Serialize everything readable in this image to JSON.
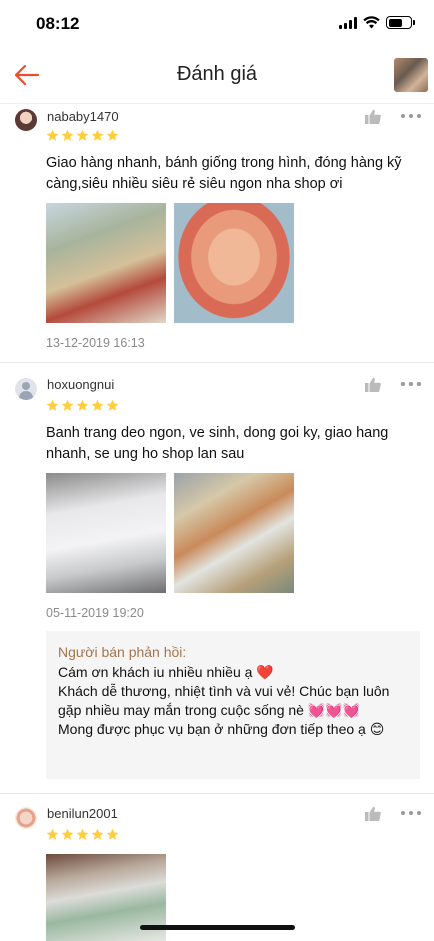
{
  "status": {
    "time": "08:12"
  },
  "header": {
    "title": "Đánh giá"
  },
  "reviews": [
    {
      "username": "nababy1470",
      "rating": 5,
      "comment": "Giao hàng nhanh, bánh giống trong hình, đóng hàng kỹ càng,siêu nhiều siêu rẻ siêu ngon nha shop ơi",
      "photo_count": 2,
      "date": "13-12-2019 16:13"
    },
    {
      "username": "hoxuongnui",
      "rating": 5,
      "comment": "Banh trang deo ngon, ve sinh, dong goi ky, giao hang nhanh, se ung ho shop lan sau",
      "photo_count": 2,
      "date": "05-11-2019 19:20",
      "seller_reply": {
        "title": "Người bán phản hồi:",
        "text": "Cám ơn khách iu nhiều nhiều ạ ❤️\nKhách dễ thương, nhiệt tình và vui vẻ! Chúc bạn luôn gặp nhiều may mắn trong cuộc sống nè 💓💓💓\nMong được phục vụ bạn ở những đơn tiếp theo ạ 😊"
      }
    },
    {
      "username": "benilun2001",
      "rating": 5,
      "photo_count": 1
    }
  ],
  "colors": {
    "accent": "#ee4d2d",
    "star": "#ffce3d",
    "reply_title": "#a5754a"
  }
}
